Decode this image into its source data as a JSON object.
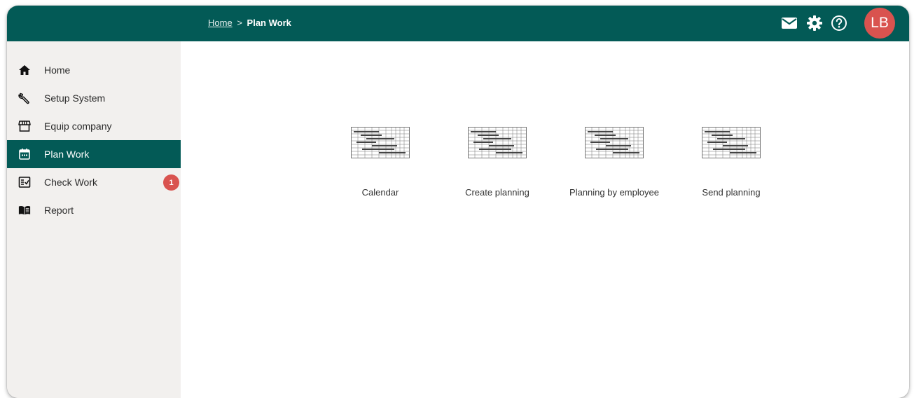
{
  "colors": {
    "brand": "#035a56",
    "sidebar_bg": "#f2f0ee",
    "badge": "#d9534f",
    "avatar": "#d9534f"
  },
  "header": {
    "breadcrumb": {
      "home": "Home",
      "separator": ">",
      "current": "Plan Work"
    },
    "icons": [
      "mail-icon",
      "gear-icon",
      "help-icon"
    ],
    "avatar_initials": "LB"
  },
  "sidebar": {
    "items": [
      {
        "label": "Home",
        "icon": "home-icon",
        "active": false
      },
      {
        "label": "Setup System",
        "icon": "wrench-icon",
        "active": false
      },
      {
        "label": "Equip company",
        "icon": "store-icon",
        "active": false
      },
      {
        "label": "Plan Work",
        "icon": "calendar-icon",
        "active": true
      },
      {
        "label": "Check Work",
        "icon": "checklist-icon",
        "active": false,
        "badge": "1"
      },
      {
        "label": "Report",
        "icon": "book-icon",
        "active": false
      }
    ]
  },
  "main": {
    "tiles": [
      {
        "label": "Calendar",
        "icon": "gantt-thumbnail-icon"
      },
      {
        "label": "Create planning",
        "icon": "gantt-thumbnail-icon"
      },
      {
        "label": "Planning by employee",
        "icon": "gantt-thumbnail-icon"
      },
      {
        "label": "Send planning",
        "icon": "gantt-thumbnail-icon"
      }
    ]
  }
}
